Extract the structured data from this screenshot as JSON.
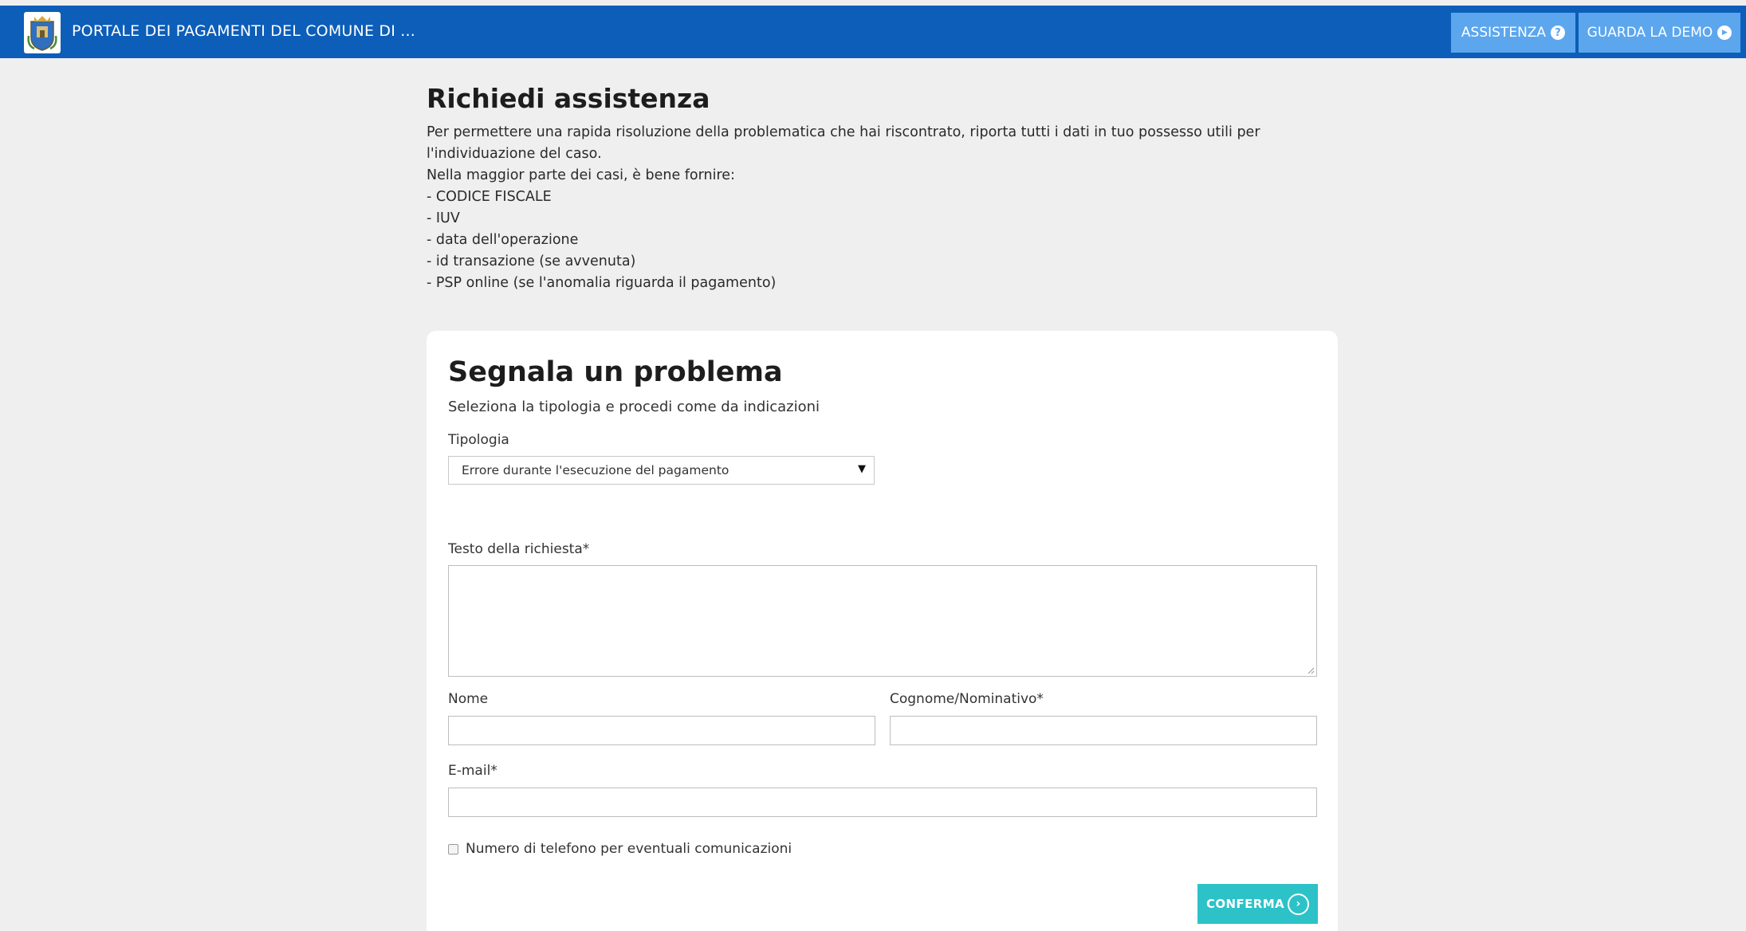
{
  "header": {
    "title": "PORTALE DEI PAGAMENTI DEL COMUNE DI ...",
    "help_button": "ASSISTENZA",
    "help_icon": "?",
    "demo_button": "GUARDA LA DEMO",
    "demo_icon": "▶",
    "crest_icon": "municipal-crest-icon"
  },
  "intro": {
    "title": "Richiedi assistenza",
    "lines": [
      "Per permettere una rapida risoluzione della problematica che hai riscontrato, riporta tutti i dati in tuo possesso utili per",
      "l'individuazione del caso.",
      "Nella maggior parte dei casi, è bene fornire:",
      "- CODICE FISCALE",
      "- IUV",
      "- data dell'operazione",
      "- id transazione (se avvenuta)",
      "- PSP online (se l'anomalia riguarda il pagamento)"
    ]
  },
  "form": {
    "title": "Segnala un problema",
    "subtitle": "Seleziona la tipologia e procedi come da indicazioni",
    "type_label": "Tipologia",
    "type_value": "Errore durante l'esecuzione del pagamento",
    "text_label": "Testo della richiesta*",
    "name_label": "Nome",
    "surname_label": "Cognome/Nominativo*",
    "email_label": "E-mail*",
    "phone_checkbox_label": "Numero di telefono per eventuali comunicazioni",
    "submit_label": "CONFERMA",
    "submit_icon": "›"
  },
  "colors": {
    "header_bg": "#0c5eb9",
    "header_button_bg": "#5ca6ee",
    "submit_bg": "#2dc2c7",
    "page_bg": "#efefef"
  }
}
